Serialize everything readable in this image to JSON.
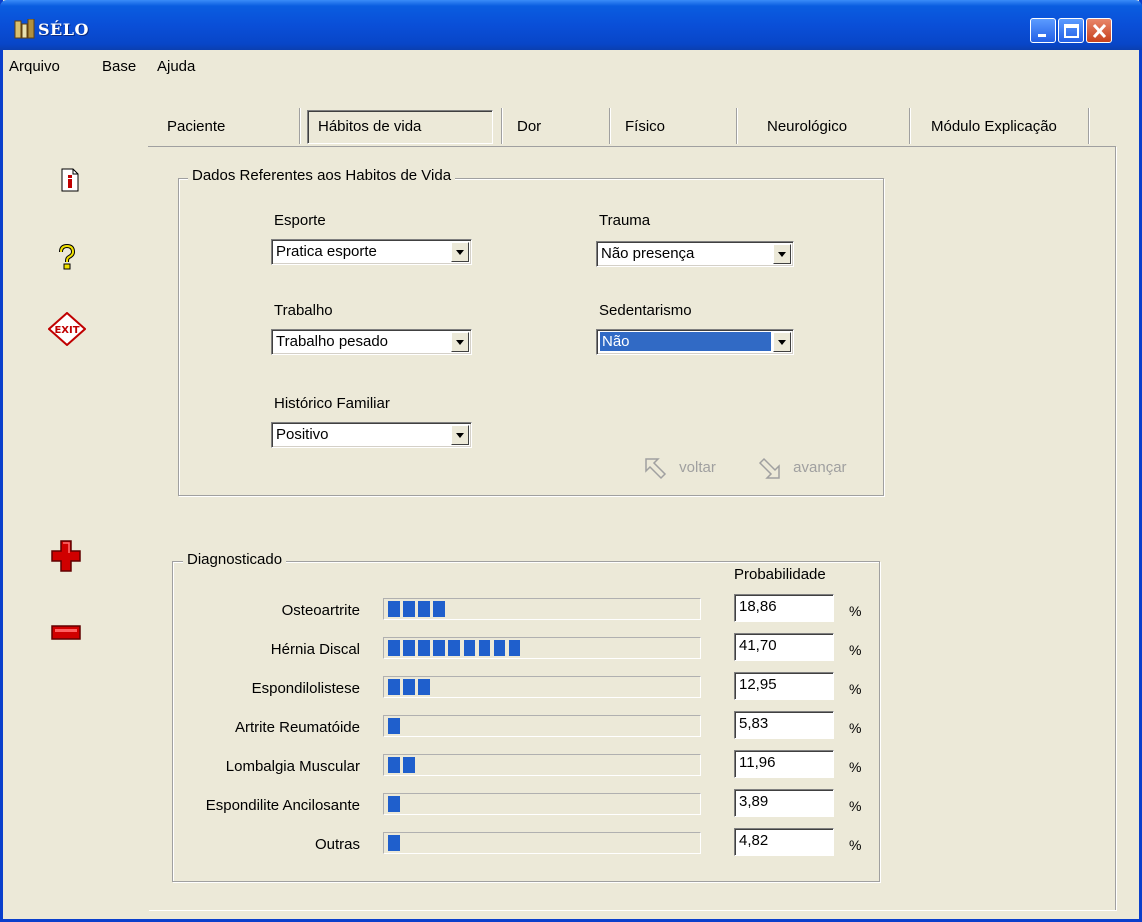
{
  "window": {
    "title": "SÉLO",
    "accent": "#0a4fd8"
  },
  "menu": {
    "items": [
      "Arquivo",
      "Base",
      "Ajuda"
    ]
  },
  "tabs": [
    "Paciente",
    "Hábitos de vida",
    "Dor",
    "Físico",
    "Neurológico",
    "Módulo Explicação"
  ],
  "active_tab": "Hábitos de vida",
  "side_icons": [
    "info-icon",
    "help-icon",
    "exit-icon",
    "add-icon",
    "remove-icon"
  ],
  "habits": {
    "legend": "Dados Referentes aos Habitos de Vida",
    "esporte": {
      "label": "Esporte",
      "value": "Pratica esporte"
    },
    "trauma": {
      "label": "Trauma",
      "value": "Não presença"
    },
    "trabalho": {
      "label": "Trabalho",
      "value": "Trabalho pesado"
    },
    "sedentarismo": {
      "label": "Sedentarismo",
      "value": "Não"
    },
    "historico": {
      "label": "Histórico Familiar",
      "value": "Positivo"
    },
    "voltar": "voltar",
    "avancar": "avançar"
  },
  "diagnosis": {
    "legend": "Diagnosticado",
    "prob_header": "Probabilidade",
    "percent_sign": "%",
    "bar_color": "#1f5fcc",
    "rows": [
      {
        "label": "Osteoartrite",
        "value": "18,86",
        "segments": 4
      },
      {
        "label": "Hérnia Discal",
        "value": "41,70",
        "segments": 9
      },
      {
        "label": "Espondilolistese",
        "value": "12,95",
        "segments": 3
      },
      {
        "label": "Artrite Reumatóide",
        "value": "5,83",
        "segments": 1
      },
      {
        "label": "Lombalgia Muscular",
        "value": "11,96",
        "segments": 2
      },
      {
        "label": "Espondilite Ancilosante",
        "value": "3,89",
        "segments": 1
      },
      {
        "label": "Outras",
        "value": "4,82",
        "segments": 1
      }
    ]
  }
}
